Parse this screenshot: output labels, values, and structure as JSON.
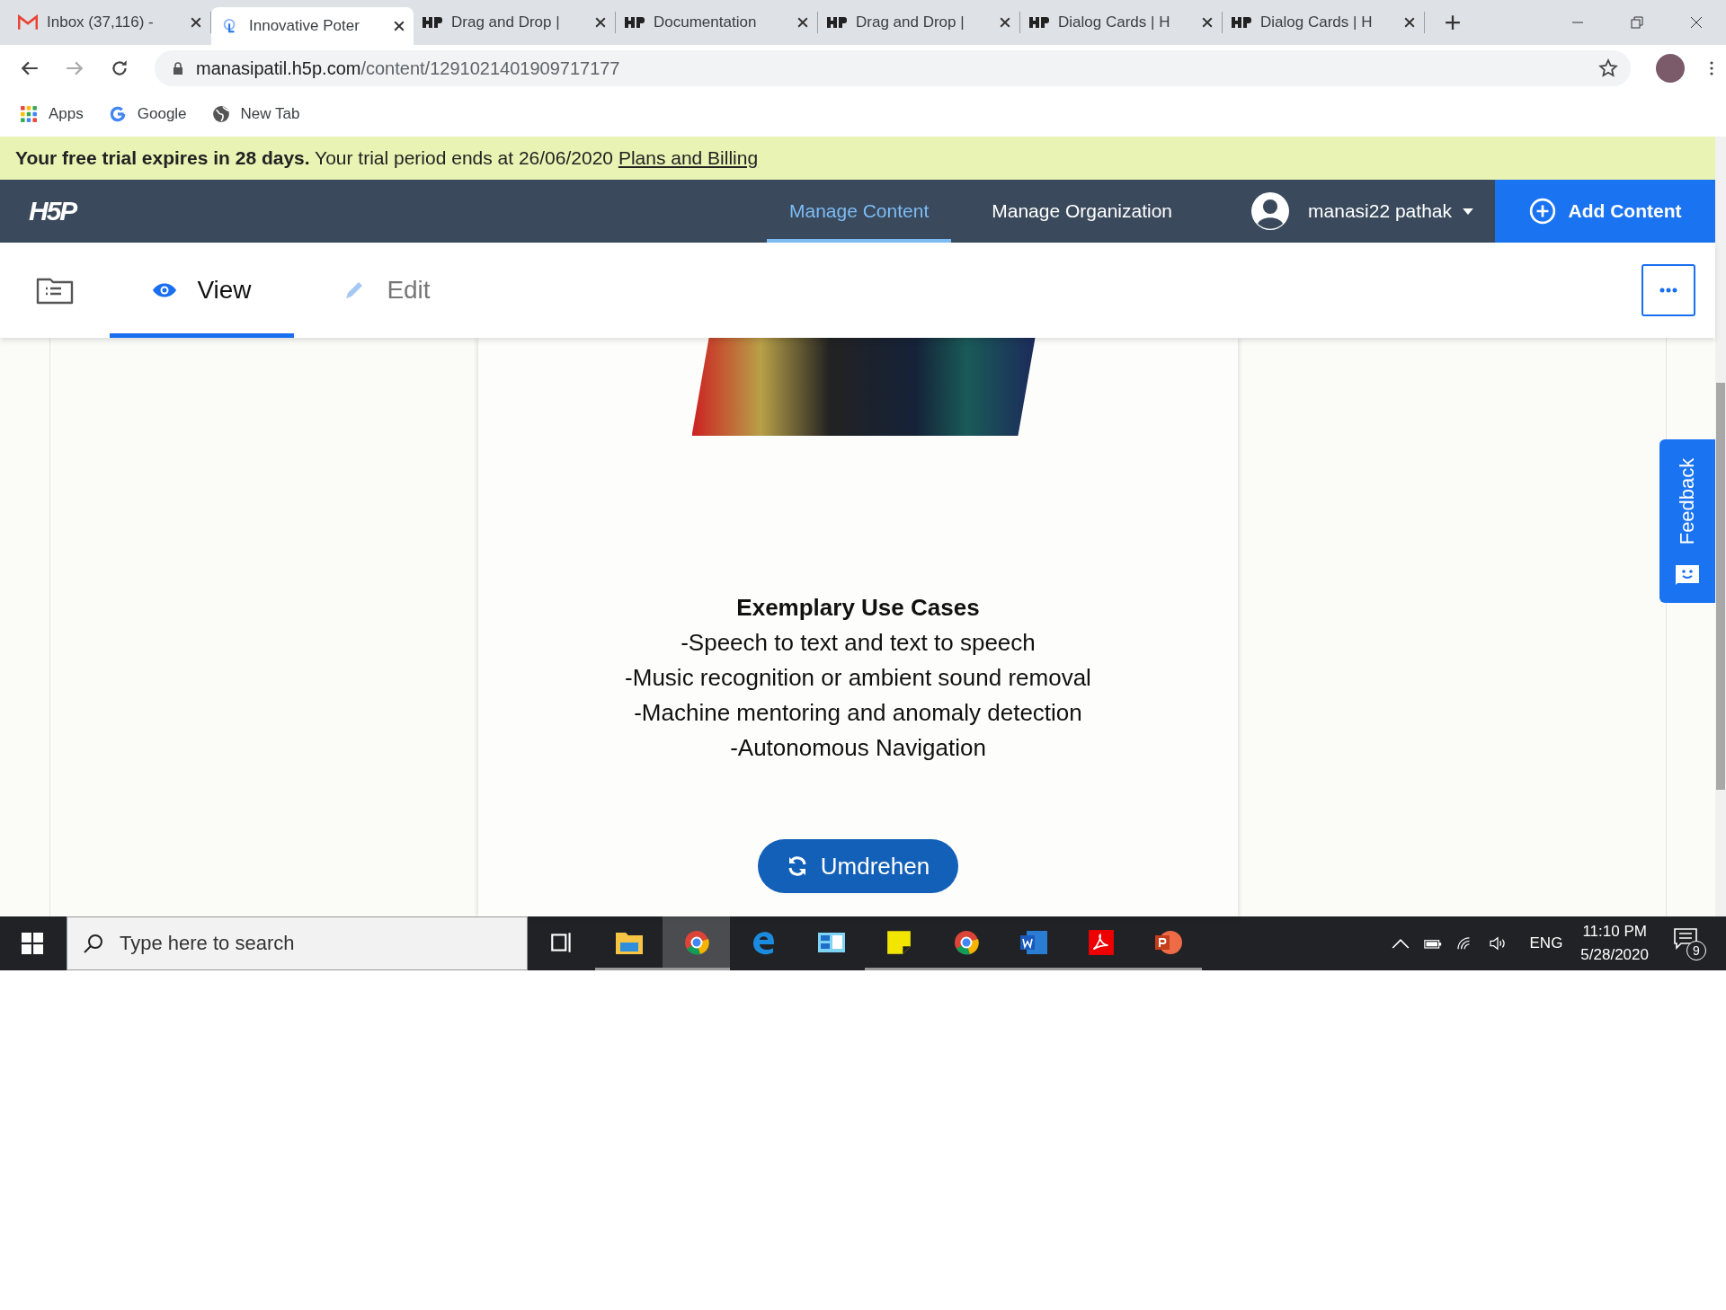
{
  "browser": {
    "tabs": [
      {
        "title": "Inbox (37,116) -",
        "kind": "mail",
        "selected": false
      },
      {
        "title": "Innovative Poter",
        "kind": "touch",
        "selected": true
      },
      {
        "title": "Drag and Drop |",
        "kind": "h5p",
        "selected": false
      },
      {
        "title": "Documentation",
        "kind": "h5p",
        "selected": false
      },
      {
        "title": "Drag and Drop |",
        "kind": "h5p",
        "selected": false
      },
      {
        "title": "Dialog Cards | H",
        "kind": "h5p",
        "selected": false
      },
      {
        "title": "Dialog Cards | H",
        "kind": "h5p",
        "selected": false
      }
    ],
    "url": {
      "host": "manasipatil.h5p.com",
      "path": "/content/1291021401909717177"
    },
    "bookmarks": [
      {
        "label": "Apps",
        "kind": "apps"
      },
      {
        "label": "Google",
        "kind": "google"
      },
      {
        "label": "New Tab",
        "kind": "globe"
      }
    ]
  },
  "trial_banner": {
    "text": "**Your free trial expires in 28 days.** Your trial period ends at 26/06/2020",
    "link": "Plans and Billing"
  },
  "nav": {
    "logo": "H5P",
    "items": [
      {
        "label": "Manage Content",
        "selected": true
      },
      {
        "label": "Manage Organization",
        "selected": false
      }
    ],
    "user": "manasi22 pathak",
    "add_button": "Add Content"
  },
  "toolbar": {
    "tabs": [
      {
        "label": "View",
        "kind": "view",
        "selected": true
      },
      {
        "label": "Edit",
        "kind": "edit",
        "selected": false
      }
    ]
  },
  "card": {
    "heading": "Exemplary Use Cases",
    "lines": [
      "-Speech to text and text to speech",
      "-Music recognition or ambient sound removal",
      "-Machine mentoring and anomaly detection",
      "-Autonomous Navigation"
    ],
    "button": "Umdrehen"
  },
  "feedback": "Feedback",
  "taskbar": {
    "search_placeholder": "Type here to search",
    "apps": [
      {
        "kind": "taskview",
        "running": false,
        "selected": false
      },
      {
        "kind": "folder",
        "running": true,
        "selected": false
      },
      {
        "kind": "chrome",
        "running": true,
        "selected": true
      },
      {
        "kind": "edge",
        "running": false,
        "selected": false
      },
      {
        "kind": "calc",
        "running": false,
        "selected": false
      },
      {
        "kind": "notes",
        "running": true,
        "selected": false
      },
      {
        "kind": "chrome",
        "running": true,
        "selected": false
      },
      {
        "kind": "word",
        "running": true,
        "selected": false
      },
      {
        "kind": "pdf",
        "running": true,
        "selected": false
      },
      {
        "kind": "ppt",
        "running": true,
        "selected": false
      }
    ],
    "language": "ENG",
    "time": "11:10 PM",
    "date": "5/28/2020",
    "notifications": "9"
  }
}
